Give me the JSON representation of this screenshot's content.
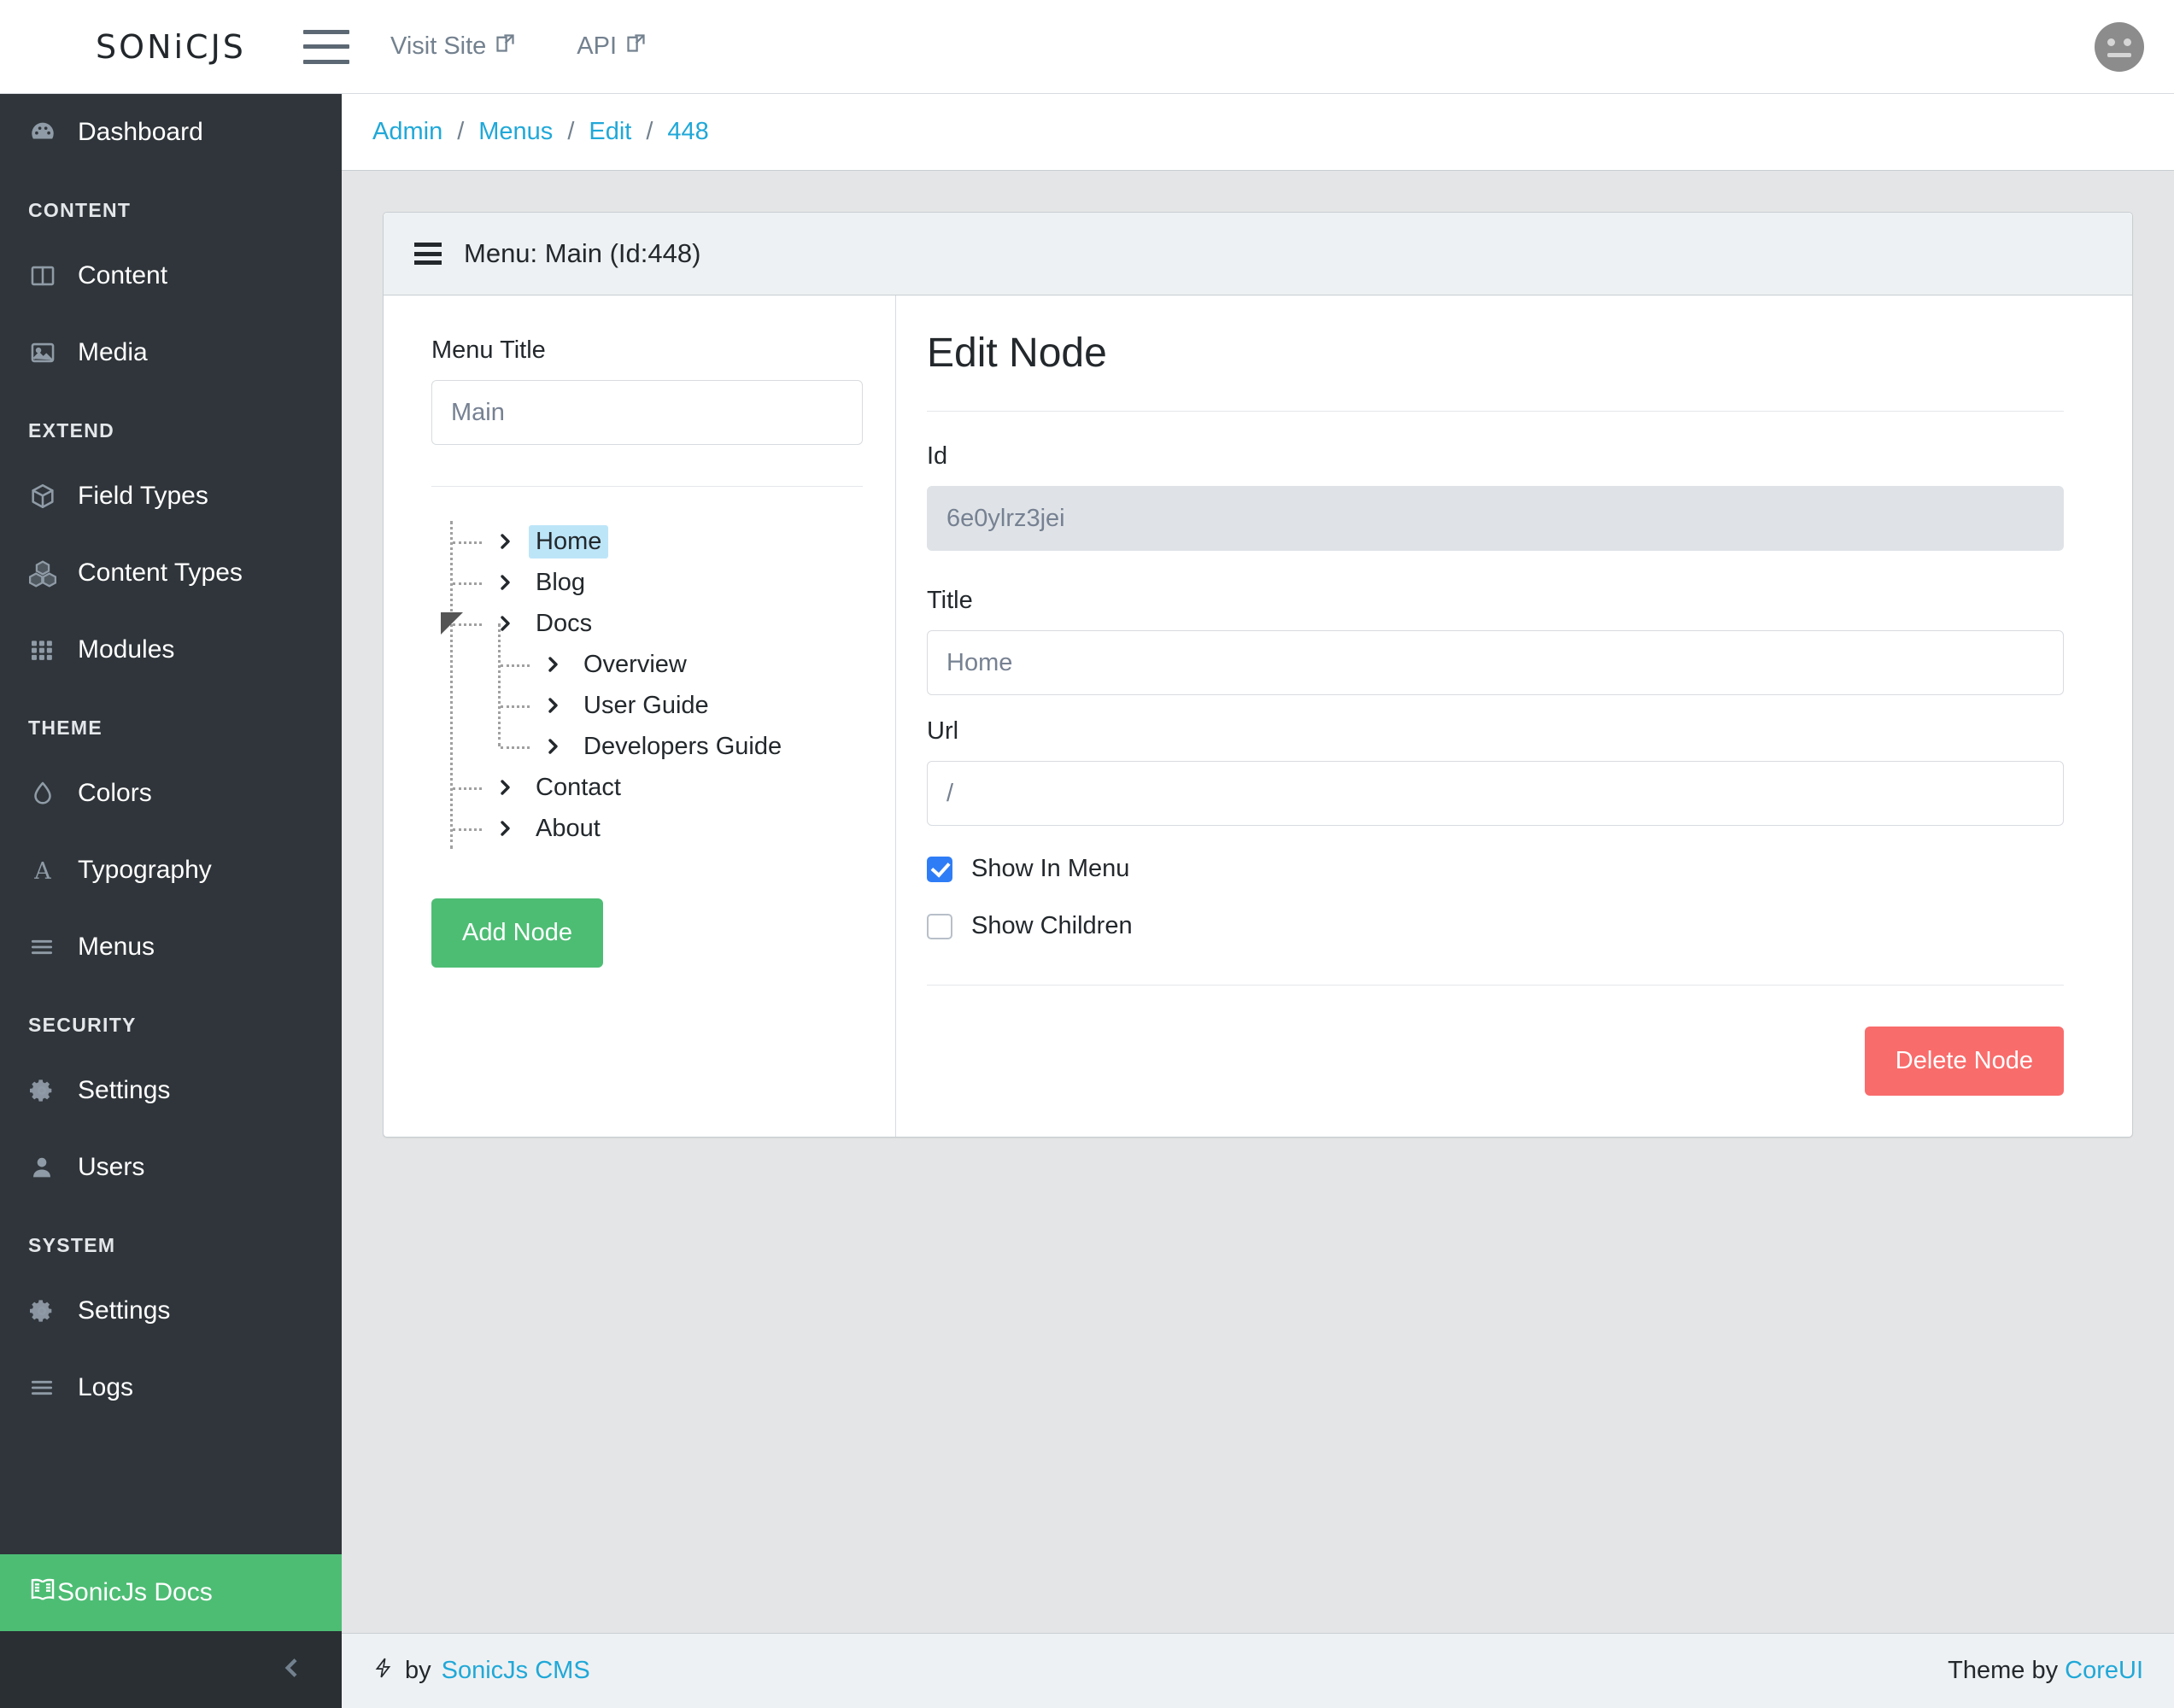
{
  "header": {
    "brand": "SONiCJS",
    "menu_toggle": "hamburger-icon",
    "links": [
      {
        "label": "Visit Site",
        "icon": "external-link-icon"
      },
      {
        "label": "API",
        "icon": "external-link-icon"
      }
    ],
    "avatar": "user-avatar"
  },
  "sidebar": {
    "groups": [
      {
        "title": null,
        "items": [
          {
            "label": "Dashboard",
            "icon": "speedometer-icon"
          }
        ]
      },
      {
        "title": "CONTENT",
        "items": [
          {
            "label": "Content",
            "icon": "columns-icon"
          },
          {
            "label": "Media",
            "icon": "image-icon"
          }
        ]
      },
      {
        "title": "EXTEND",
        "items": [
          {
            "label": "Field Types",
            "icon": "cube-icon"
          },
          {
            "label": "Content Types",
            "icon": "cubes-icon"
          },
          {
            "label": "Modules",
            "icon": "grid-icon"
          }
        ]
      },
      {
        "title": "THEME",
        "items": [
          {
            "label": "Colors",
            "icon": "droplet-icon"
          },
          {
            "label": "Typography",
            "icon": "letter-a-icon"
          },
          {
            "label": "Menus",
            "icon": "list-icon"
          }
        ]
      },
      {
        "title": "SECURITY",
        "items": [
          {
            "label": "Settings",
            "icon": "gear-icon"
          },
          {
            "label": "Users",
            "icon": "user-icon"
          }
        ]
      },
      {
        "title": "SYSTEM",
        "items": [
          {
            "label": "Settings",
            "icon": "gear-icon"
          },
          {
            "label": "Logs",
            "icon": "list-icon"
          }
        ]
      }
    ],
    "docs_link": {
      "label": "SonicJs Docs",
      "icon": "book-icon",
      "color": "#4dbd74"
    },
    "minimizer": "chevron-left-icon"
  },
  "breadcrumb": {
    "items": [
      "Admin",
      "Menus",
      "Edit",
      "448"
    ],
    "separator": "/"
  },
  "card": {
    "header_title": "Menu: Main (Id:448)",
    "header_icon": "menu-icon"
  },
  "menu_panel": {
    "title_label": "Menu Title",
    "title_value": "Main",
    "add_node_label": "Add Node",
    "tree": [
      {
        "label": "Home",
        "selected": true,
        "children": []
      },
      {
        "label": "Blog",
        "selected": false,
        "children": []
      },
      {
        "label": "Docs",
        "selected": false,
        "expanded": true,
        "children": [
          {
            "label": "Overview"
          },
          {
            "label": "User Guide"
          },
          {
            "label": "Developers Guide"
          }
        ]
      },
      {
        "label": "Contact",
        "selected": false,
        "children": []
      },
      {
        "label": "About",
        "selected": false,
        "children": []
      }
    ]
  },
  "edit_node": {
    "heading": "Edit Node",
    "id_label": "Id",
    "id_value": "6e0ylrz3jei",
    "title_label": "Title",
    "title_value": "Home",
    "url_label": "Url",
    "url_value": "/",
    "show_in_menu_label": "Show In Menu",
    "show_in_menu_checked": true,
    "show_children_label": "Show Children",
    "show_children_checked": false,
    "delete_label": "Delete Node",
    "delete_color": "#f86c6b"
  },
  "footer": {
    "left_prefix": "by",
    "left_link": "SonicJs CMS",
    "right_prefix": "Theme by",
    "right_link": "CoreUI",
    "bolt_icon": "lightning-icon"
  },
  "colors": {
    "accent": "#20a8d8",
    "green": "#4dbd74",
    "red": "#f86c6b",
    "sidebar_bg": "#2f353a",
    "page_bg": "#e4e5e6",
    "selected_node": "#bde5f8"
  }
}
